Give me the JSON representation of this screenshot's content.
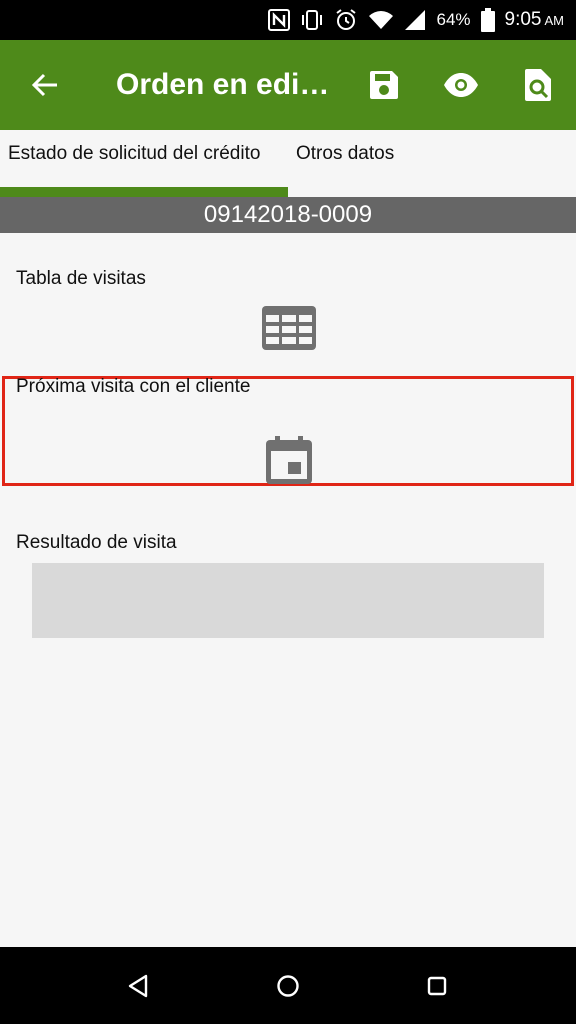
{
  "status_bar": {
    "battery": "64%",
    "time": "9:05",
    "ampm": "AM",
    "icons": [
      "nfc-icon",
      "vibrate-icon",
      "alarm-icon",
      "wifi-icon",
      "signal-icon",
      "battery-icon"
    ]
  },
  "app_bar": {
    "title": "Orden en edi…",
    "icons": [
      "back-arrow-icon",
      "save-icon",
      "eye-icon",
      "document-search-icon"
    ],
    "color": "#4e8a1a"
  },
  "tabs": [
    {
      "label": "Estado de solicitud del crédito",
      "selected": true
    },
    {
      "label": "Otros datos",
      "selected": false
    }
  ],
  "order_number": "09142018-0009",
  "sections": {
    "visit_table": {
      "label": "Tabla de visitas",
      "icon": "table-icon"
    },
    "next_visit": {
      "label": "Próxima visita con el cliente",
      "icon": "calendar-icon",
      "highlight_color": "#e02516"
    },
    "visit_result": {
      "label": "Resultado de visita",
      "value": ""
    }
  },
  "nav_bar": {
    "icons": [
      "back-triangle-icon",
      "home-circle-icon",
      "recents-square-icon"
    ]
  }
}
